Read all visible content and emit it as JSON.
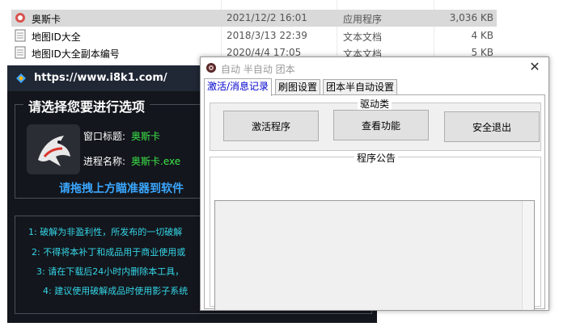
{
  "explorer": {
    "files": [
      {
        "name": "奥斯卡",
        "date": "2021/12/2 16:01",
        "type": "应用程序",
        "size": "3,036 KB",
        "selected": true
      },
      {
        "name": "地图ID大全",
        "date": "2018/3/13 22:39",
        "type": "文本文档",
        "size": "4 KB",
        "selected": false
      },
      {
        "name": "地图ID大全副本编号",
        "date": "2020/4/4 17:05",
        "type": "文本文档",
        "size": "5 KB",
        "selected": false
      }
    ]
  },
  "tool_window": {
    "title": "https://www.i8k1.com/",
    "group_title": "请选择您要进行选项",
    "window_title_label": "窗口标题:",
    "window_title_value": "奥斯卡",
    "process_label": "进程名称:",
    "process_value": "奥斯卡.exe",
    "drag_hint": "请拖拽上方瞄准器到软件",
    "notices": [
      "1: 破解为非盈利性，所发布的一切破解",
      "2: 不得将本补丁和成品用于商业使用或",
      "3: 请在下载后24小时内删除本工具，",
      "4: 建议使用破解成品时使用影子系统"
    ]
  },
  "dialog": {
    "title": "自动 半自动 团本",
    "close_symbol": "✕",
    "tabs": [
      "激活/消息记录",
      "刷图设置",
      "团本半自动设置"
    ],
    "driver_group_title": "驱动类",
    "buttons": {
      "activate": "激活程序",
      "view_features": "查看功能",
      "safe_exit": "安全退出"
    },
    "notice_group_title": "程序公告"
  },
  "colors": {
    "dark_bg": "#13161c",
    "dark_title_bg": "#202735",
    "green_value": "#3ee84a",
    "blue_hint": "#3ba7ff",
    "cyan_notice": "#34d6e8",
    "active_tab_text": "#0000cc"
  }
}
